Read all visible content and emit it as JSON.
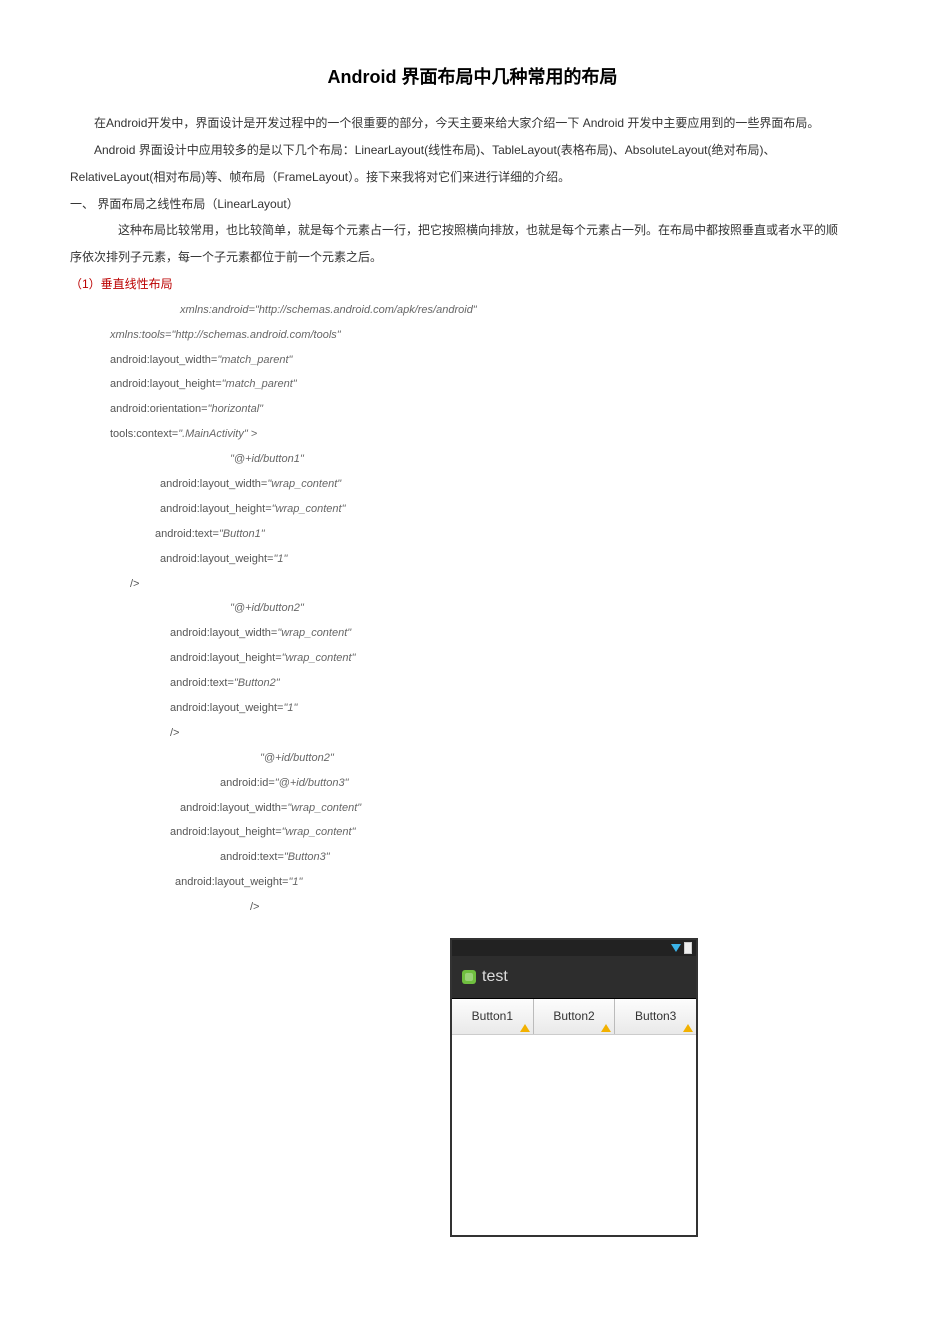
{
  "title": "Android 界面布局中几种常用的布局",
  "p1": "在Android开发中，界面设计是开发过程中的一个很重要的部分，今天主要来给大家介绍一下 Android 开发中主要应用到的一些界面布局。",
  "p2": "Android 界面设计中应用较多的是以下几个布局：LinearLayout(线性布局)、TableLayout(表格布局)、AbsoluteLayout(绝对布局)、",
  "p3": "RelativeLayout(相对布局)等、帧布局（FrameLayout）。接下来我将对它们来进行详细的介绍。",
  "s1": "一、   界面布局之线性布局（LinearLayout）",
  "p4": "这种布局比较常用，也比较简单，就是每个元素占一行，把它按照横向排放，也就是每个元素占一列。在布局中都按照垂直或者水平的顺",
  "p5": "序依次排列子元素，每一个子元素都位于前一个元素之后。",
  "sub1": "（1）垂直线性布局",
  "code": {
    "c01": "xmlns:android=\"http://schemas.android.com/apk/res/android\"",
    "c02": "xmlns:tools=\"http://schemas.android.com/tools\"",
    "c03a": "android:layout_width=",
    "c03b": "\"match_parent\"",
    "c04a": "android:layout_height=",
    "c04b": "\"match_parent\"",
    "c05a": "android:orientation=",
    "c05b": "\"horizontal\"",
    "c06a": "tools:context=",
    "c06b": "\".MainActivity\" >",
    "c07": "\"@+id/button1\"",
    "c08a": "android:layout_width=",
    "c08b": "\"wrap_content\"",
    "c09a": "android:layout_height=",
    "c09b": "\"wrap_content\"",
    "c10a": "android:text=",
    "c10b": "\"Button1\"",
    "c11a": "android:layout_weight=",
    "c11b": "\"1\"",
    "c12": "/>",
    "c13": "\"@+id/button2\"",
    "c14a": "android:layout_width=",
    "c14b": "\"wrap_content\"",
    "c15a": "android:layout_height=",
    "c15b": "\"wrap_content\"",
    "c16a": "android:text=",
    "c16b": "\"Button2\"",
    "c17a": "android:layout_weight=",
    "c17b": "\"1\"",
    "c18": "/>",
    "c19": "\"@+id/button2\"",
    "c20a": "android:id=",
    "c20b": "\"@+id/button3\"",
    "c21a": "android:layout_width=",
    "c21b": "\"wrap_content\"",
    "c22a": "android:layout_height=",
    "c22b": "\"wrap_content\"",
    "c23a": "android:text=",
    "c23b": "\"Button3\"",
    "c24a": "android:layout_weight=",
    "c24b": "\"1\"",
    "c25": "/>"
  },
  "phone": {
    "app_title": "test",
    "btn1": "Button1",
    "btn2": "Button2",
    "btn3": "Button3"
  }
}
